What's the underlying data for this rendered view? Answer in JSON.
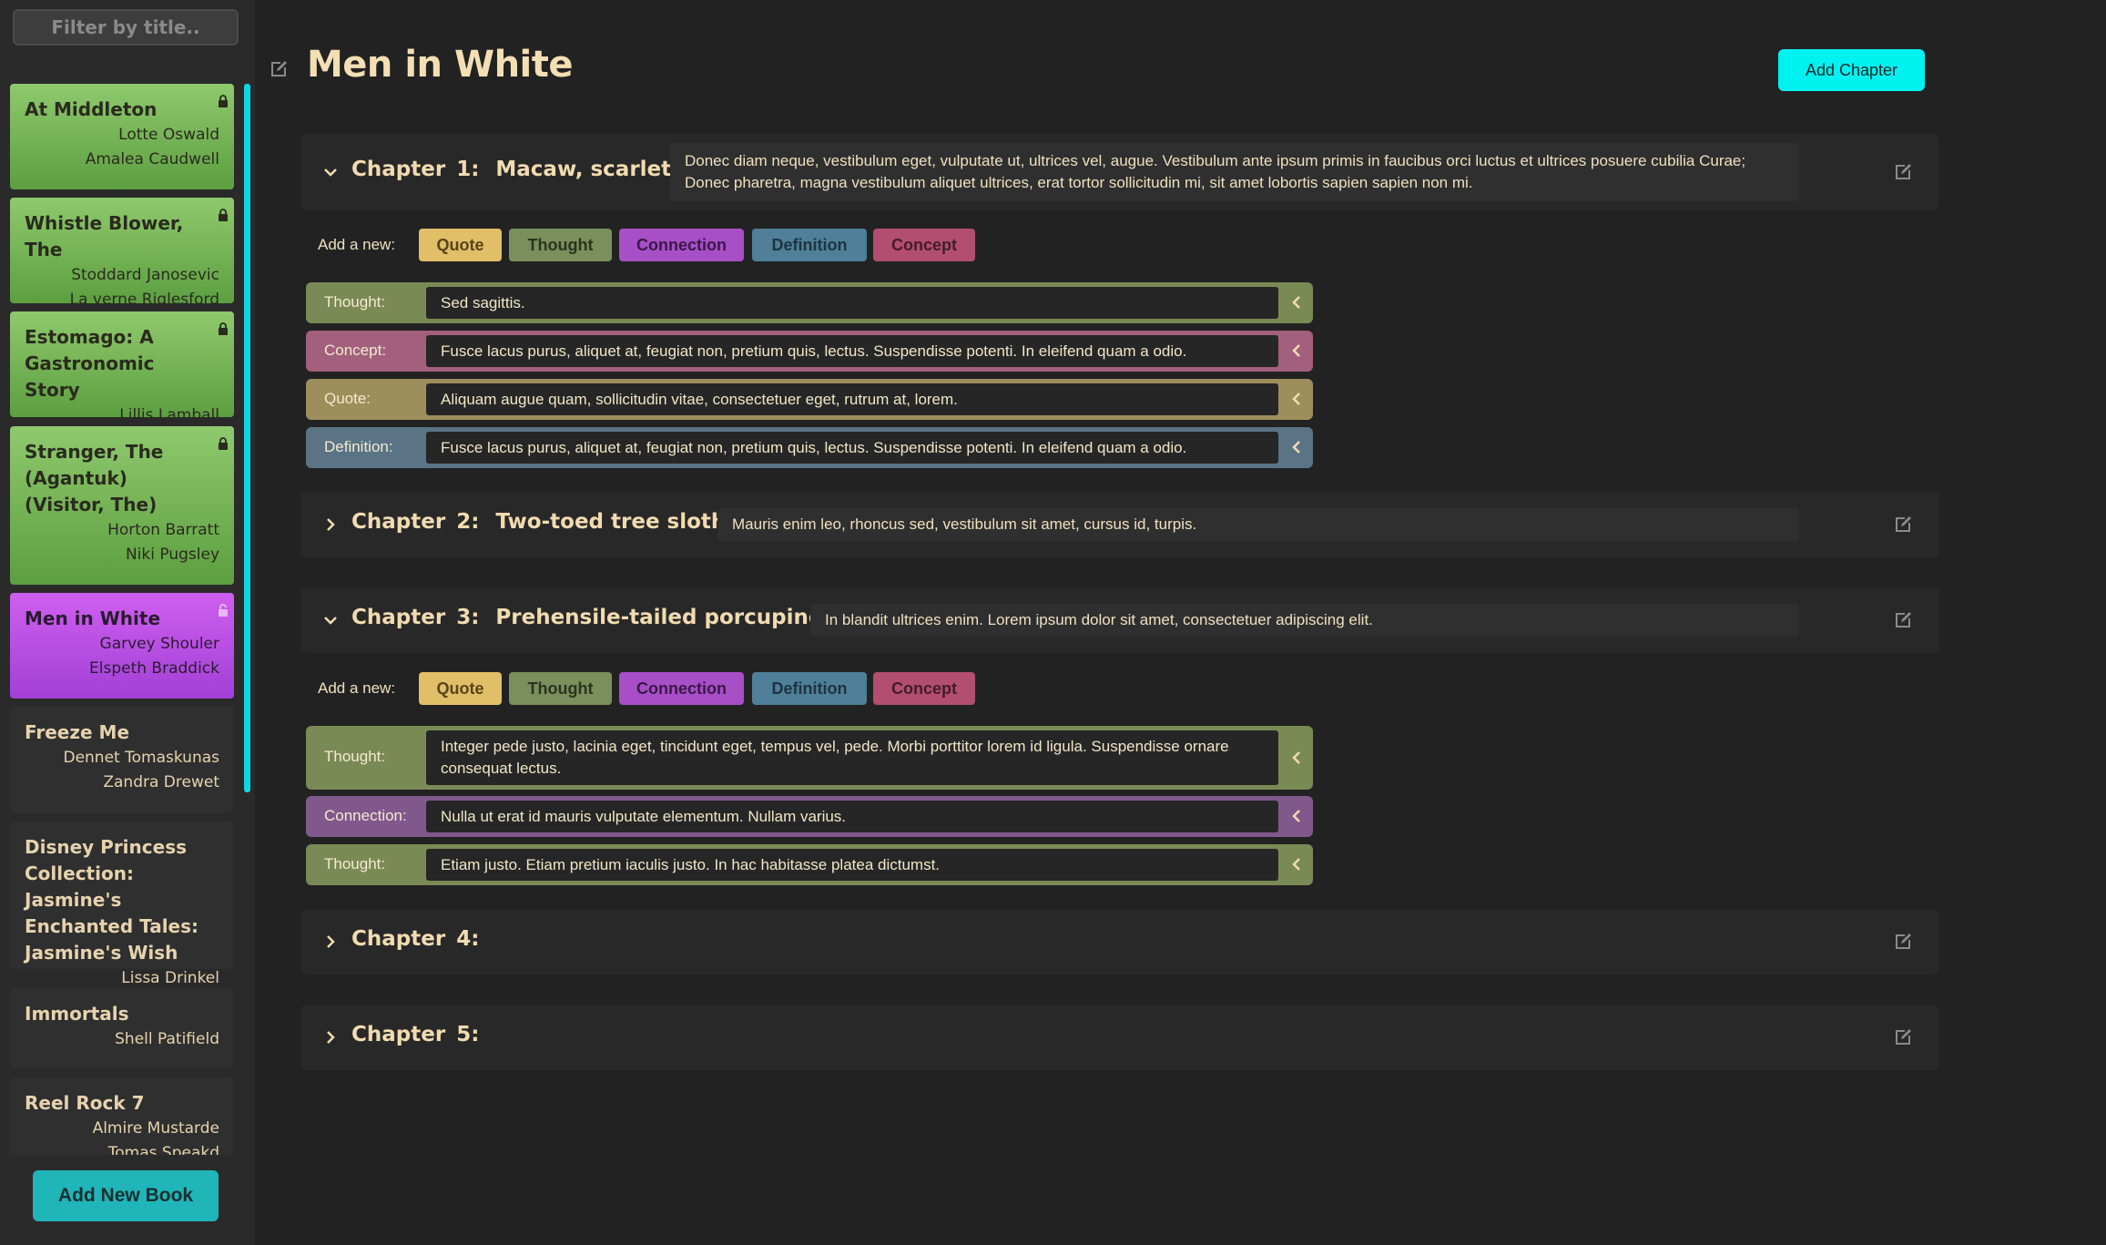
{
  "sidebar": {
    "filter_placeholder": "Filter by title..",
    "books": [
      {
        "title": "At Middleton",
        "authors": [
          "Lotte Oswald",
          "Amalea Caudwell"
        ],
        "locked": true
      },
      {
        "title": "Whistle Blower, The",
        "authors": [
          "Stoddard Janosevic",
          "La verne Riglesford"
        ],
        "locked": true
      },
      {
        "title": "Estomago: A Gastronomic Story",
        "authors": [
          "Lillis Lamball"
        ],
        "locked": true
      },
      {
        "title": "Stranger, The (Agantuk) (Visitor, The)",
        "authors": [
          "Horton Barratt",
          "Niki Pugsley"
        ],
        "locked": true
      },
      {
        "title": "Men in White",
        "authors": [
          "Garvey Shouler",
          "Elspeth Braddick"
        ],
        "locked": false,
        "selected": true
      },
      {
        "title": "Freeze Me",
        "authors": [
          "Dennet Tomaskunas",
          "Zandra Drewet"
        ]
      },
      {
        "title": "Disney Princess Collection: Jasmine's Enchanted Tales: Jasmine's Wish",
        "authors": [
          "Lissa Drinkel"
        ]
      },
      {
        "title": "Immortals",
        "authors": [
          "Shell Patifield"
        ]
      },
      {
        "title": "Reel Rock 7",
        "authors": [
          "Almire Mustarde",
          "Tomas Speakd"
        ]
      }
    ],
    "add_book_label": "Add New Book"
  },
  "main": {
    "title": "Men in White",
    "add_chapter_label": "Add Chapter",
    "add_new_label": "Add a new:",
    "note_types": [
      "Quote",
      "Thought",
      "Connection",
      "Definition",
      "Concept"
    ],
    "chapters": [
      {
        "label": "Chapter",
        "number": "1:",
        "name": "Macaw, scarlet",
        "expanded": true,
        "description": "Donec diam neque, vestibulum eget, vulputate ut, ultrices vel, augue. Vestibulum ante ipsum primis in faucibus orci luctus et ultrices posuere cubilia Curae; Donec pharetra, magna vestibulum aliquet ultrices, erat tortor sollicitudin mi, sit amet lobortis sapien sapien non mi.",
        "notes": [
          {
            "type": "Thought:",
            "text": "Sed sagittis."
          },
          {
            "type": "Concept:",
            "text": "Fusce lacus purus, aliquet at, feugiat non, pretium quis, lectus. Suspendisse potenti. In eleifend quam a odio."
          },
          {
            "type": "Quote:",
            "text": "Aliquam augue quam, sollicitudin vitae, consectetuer eget, rutrum at, lorem."
          },
          {
            "type": "Definition:",
            "text": "Fusce lacus purus, aliquet at, feugiat non, pretium quis, lectus. Suspendisse potenti. In eleifend quam a odio."
          }
        ]
      },
      {
        "label": "Chapter",
        "number": "2:",
        "name": "Two-toed tree sloth",
        "expanded": false,
        "description": "Mauris enim leo, rhoncus sed, vestibulum sit amet, cursus id, turpis."
      },
      {
        "label": "Chapter",
        "number": "3:",
        "name": "Prehensile-tailed porcupine",
        "expanded": true,
        "description": "In blandit ultrices enim. Lorem ipsum dolor sit amet, consectetuer adipiscing elit.",
        "notes": [
          {
            "type": "Thought:",
            "text": "Integer pede justo, lacinia eget, tincidunt eget, tempus vel, pede. Morbi porttitor lorem id ligula. Suspendisse ornare consequat lectus."
          },
          {
            "type": "Connection:",
            "text": "Nulla ut erat id mauris vulputate elementum. Nullam varius."
          },
          {
            "type": "Thought:",
            "text": "Etiam justo. Etiam pretium iaculis justo. In hac habitasse platea dictumst."
          }
        ]
      },
      {
        "label": "Chapter",
        "number": "4:",
        "name": "",
        "expanded": false
      },
      {
        "label": "Chapter",
        "number": "5:",
        "name": "",
        "expanded": false
      }
    ]
  },
  "colors": {
    "accent": "#00f2f0",
    "add_book": "#1fb5b9",
    "book_green": "#7ab85a",
    "book_selected": "#c057e8"
  },
  "icons": {
    "lock": "lock-icon",
    "unlock": "unlock-icon",
    "edit": "edit-icon",
    "chevron_down": "chevron-down-icon",
    "chevron_right": "chevron-right-icon",
    "chevron_left": "chevron-left-icon"
  }
}
